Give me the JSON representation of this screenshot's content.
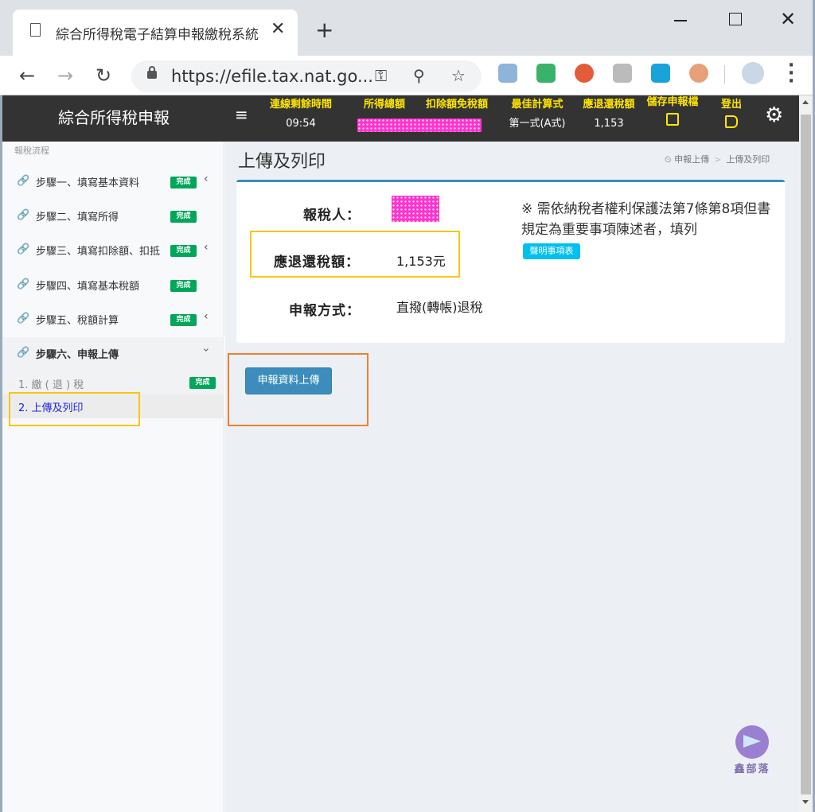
{
  "browser": {
    "tab_title": "綜合所得稅電子結算申報繳稅系統",
    "url": "https://efile.tax.nat.go...",
    "tab_close": "✕",
    "new_tab": "+",
    "close_window": "✕"
  },
  "appbar": {
    "brand": "綜合所得稅申報",
    "session_time_label": "連線剩餘時間",
    "session_time": "09:54",
    "total_income_label": "所得總額",
    "deduction_label": "扣除額免稅額",
    "best_method_label": "最佳計算式",
    "best_method": "第一式(A式)",
    "refund_label": "應退還稅額",
    "refund": "1,153",
    "save_label": "儲存申報檔",
    "logout_label": "登出",
    "accent_color": "#ffe600"
  },
  "sidebar": {
    "header": "報稅流程",
    "badge": "完成",
    "items": [
      {
        "label": "步驟一、填寫基本資料"
      },
      {
        "label": "步驟二、填寫所得"
      },
      {
        "label": "步驟三、填寫扣除額、扣抵"
      },
      {
        "label": "步驟四、填寫基本稅額"
      },
      {
        "label": "步驟五、稅額計算"
      },
      {
        "label": "步驟六、申報上傳"
      }
    ],
    "sub_items": [
      {
        "label": "1. 繳 ( 退 ) 稅"
      },
      {
        "label": "2. 上傳及列印"
      }
    ]
  },
  "main": {
    "title": "上傳及列印",
    "breadcrumb": [
      "申報上傳",
      "上傳及列印"
    ],
    "taxpayer_label": "報稅人：",
    "refund_label": "應退還稅額：",
    "refund_value": "1,153元",
    "method_label": "申報方式：",
    "method_value": "直撥(轉帳)退稅",
    "note": "※ 需依納稅者權利保護法第7條第8項但書規定為重要事項陳述者，填列",
    "note_button": "聲明事項表",
    "upload_button": "申報資料上傳"
  },
  "watermark": {
    "text": "鑫部落"
  }
}
